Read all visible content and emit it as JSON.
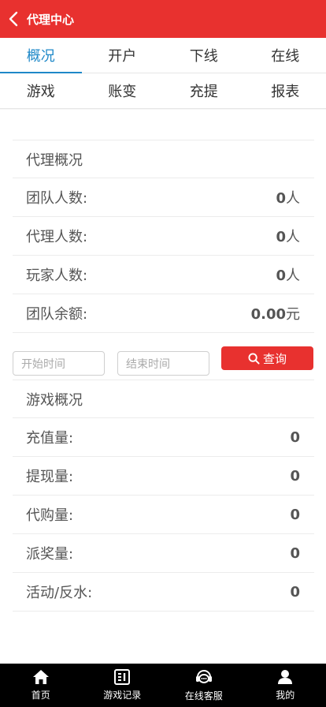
{
  "header": {
    "title": "代理中心"
  },
  "tabs": {
    "row1": [
      "概况",
      "开户",
      "下线",
      "在线"
    ],
    "row2": [
      "游戏",
      "账变",
      "充提",
      "报表"
    ]
  },
  "agent_overview": {
    "heading": "代理概况",
    "rows": [
      {
        "label": "团队人数:",
        "value": "0",
        "unit": "人"
      },
      {
        "label": "代理人数:",
        "value": "0",
        "unit": "人"
      },
      {
        "label": "玩家人数:",
        "value": "0",
        "unit": "人"
      },
      {
        "label": "团队余额:",
        "value": "0.00",
        "unit": "元"
      }
    ]
  },
  "query": {
    "start_placeholder": "开始时间",
    "end_placeholder": "结束时间",
    "button_label": "查询"
  },
  "game_overview": {
    "heading": "游戏概况",
    "rows": [
      {
        "label": "充值量:",
        "value": "0"
      },
      {
        "label": "提现量:",
        "value": "0"
      },
      {
        "label": "代购量:",
        "value": "0"
      },
      {
        "label": "派奖量:",
        "value": "0"
      },
      {
        "label": "活动/反水:",
        "value": "0"
      }
    ]
  },
  "bottom_nav": [
    {
      "label": "首页",
      "icon": "home-icon"
    },
    {
      "label": "游戏记录",
      "icon": "record-icon"
    },
    {
      "label": "在线客服",
      "icon": "support-icon"
    },
    {
      "label": "我的",
      "icon": "user-icon"
    }
  ],
  "colors": {
    "brand_red": "#e8312f",
    "active_tab": "#1e88c8"
  }
}
